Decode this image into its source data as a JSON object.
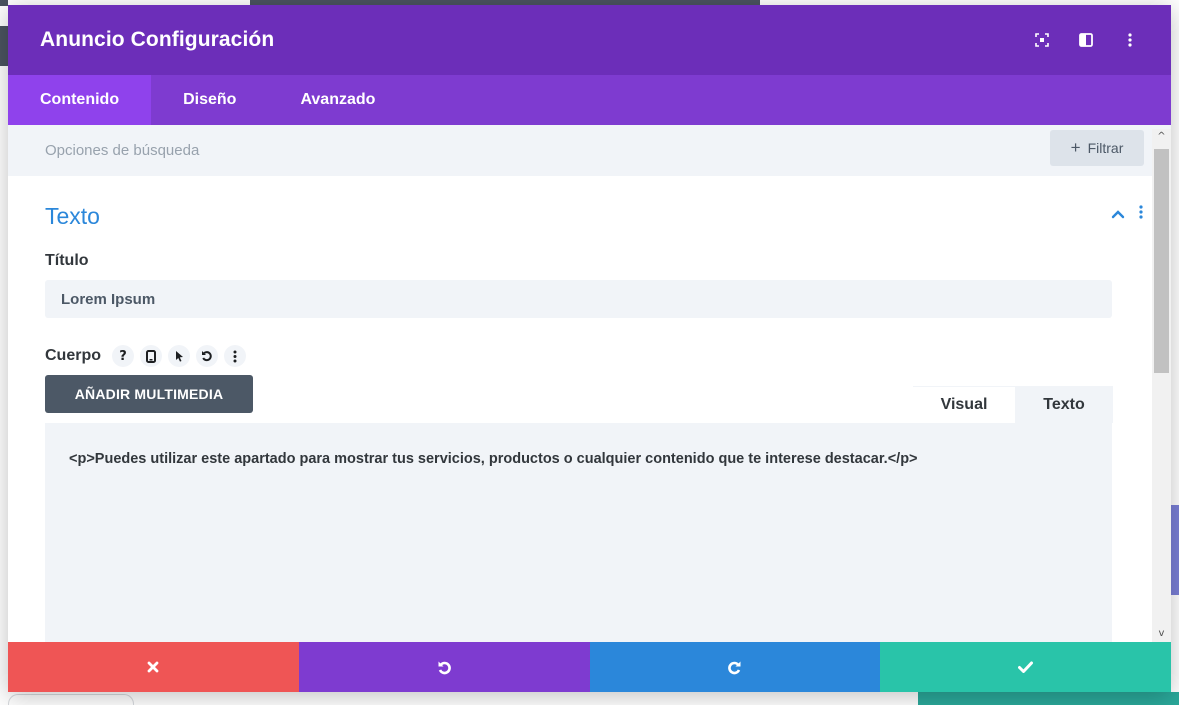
{
  "header": {
    "title": "Anuncio Configuración",
    "icons": [
      "expand-icon",
      "split-view-icon",
      "more-vertical-icon"
    ]
  },
  "tabs": [
    {
      "label": "Contenido",
      "active": true
    },
    {
      "label": "Diseño",
      "active": false
    },
    {
      "label": "Avanzado",
      "active": false
    }
  ],
  "search": {
    "placeholder": "Opciones de búsqueda",
    "filter_label": "Filtrar"
  },
  "section": {
    "title": "Texto",
    "expanded": true
  },
  "fields": {
    "title_label": "Título",
    "title_value": "Lorem Ipsum",
    "body_label": "Cuerpo",
    "body_icons": [
      "help-icon",
      "mobile-icon",
      "pointer-icon",
      "reset-icon",
      "more-vertical-icon"
    ],
    "add_media_label": "AÑADIR MULTIMEDIA",
    "editor_tabs": [
      "Visual",
      "Texto"
    ],
    "active_editor_tab": "Texto",
    "body_value": "<p>Puedes utilizar este apartado para mostrar tus servicios, productos o cualquier contenido que te interese destacar.</p>"
  },
  "footer": {
    "buttons": [
      "close-icon",
      "undo-icon",
      "redo-icon",
      "check-icon"
    ]
  },
  "colors": {
    "header": "#6c2eb9",
    "tabs": "#7e3bd0",
    "active_tab": "#8f42ec",
    "accent_blue": "#2b87da",
    "cancel": "#ef5555",
    "save": "#29c4a9"
  }
}
